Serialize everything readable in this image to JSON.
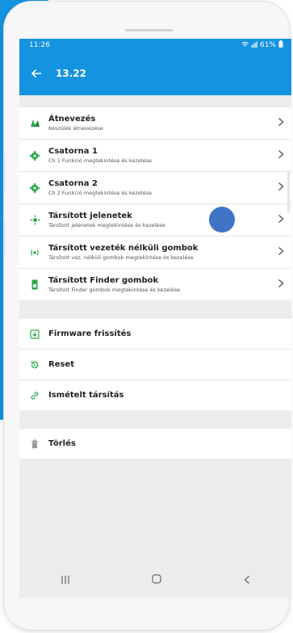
{
  "status": {
    "time": "11:26",
    "battery": "61%"
  },
  "appbar": {
    "title": "13.22"
  },
  "menu": [
    {
      "label": "Átnevezés",
      "sub": "Készülék átnevezése",
      "icon": "rename-icon"
    },
    {
      "label": "Csatorna 1",
      "sub": "Ch 1 Funkció megtekintése és kezelése",
      "icon": "gear-icon"
    },
    {
      "label": "Csatorna 2",
      "sub": "Ch 2 Funkció megtekintése és kezelése",
      "icon": "gear-icon"
    },
    {
      "label": "Társított jelenetek",
      "sub": "Társított jelenetek megtekintése és kezelése",
      "icon": "scene-icon"
    },
    {
      "label": "Társított vezeték nélküli gombok",
      "sub": "Társított vez. nélküli gombok megtekintése és kezelése",
      "icon": "wireless-icon"
    },
    {
      "label": "Társított Finder gombok",
      "sub": "Társított Finder gombok megtekintése és kezelése",
      "icon": "finder-button-icon"
    }
  ],
  "actions": [
    {
      "label": "Firmware frissítés",
      "icon": "firmware-download-icon"
    },
    {
      "label": "Reset",
      "icon": "reset-icon"
    },
    {
      "label": "Ismételt társítás",
      "icon": "link-icon"
    }
  ],
  "delete": {
    "label": "Törlés",
    "icon": "trash-icon"
  },
  "colors": {
    "primary": "#1493e0",
    "accent_green": "#2aa84a",
    "touch": "#3f74c7"
  }
}
